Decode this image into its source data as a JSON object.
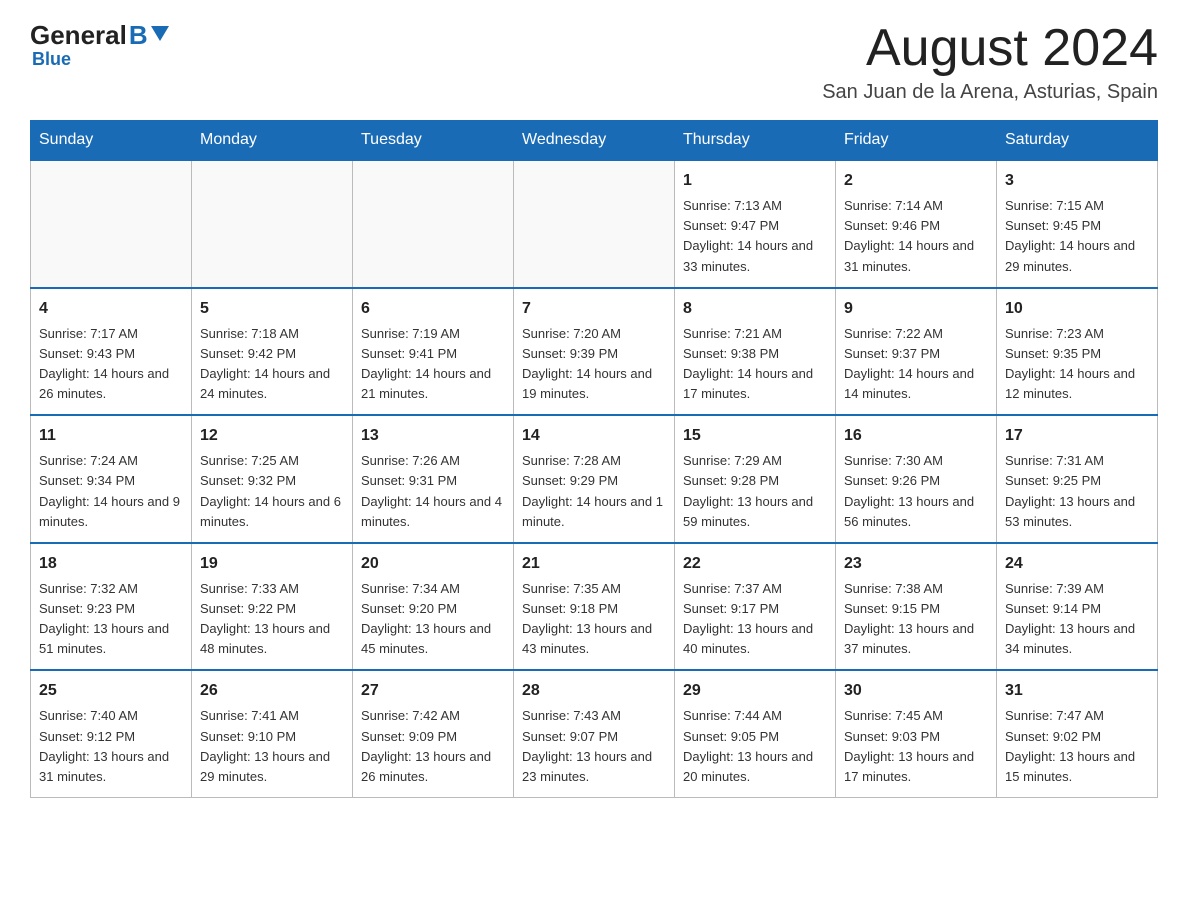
{
  "logo": {
    "text_general": "General",
    "text_blue": "Blue",
    "subtext": "Blue"
  },
  "header": {
    "month_title": "August 2024",
    "location": "San Juan de la Arena, Asturias, Spain"
  },
  "days_of_week": [
    "Sunday",
    "Monday",
    "Tuesday",
    "Wednesday",
    "Thursday",
    "Friday",
    "Saturday"
  ],
  "weeks": [
    [
      {
        "day": "",
        "info": ""
      },
      {
        "day": "",
        "info": ""
      },
      {
        "day": "",
        "info": ""
      },
      {
        "day": "",
        "info": ""
      },
      {
        "day": "1",
        "info": "Sunrise: 7:13 AM\nSunset: 9:47 PM\nDaylight: 14 hours and 33 minutes."
      },
      {
        "day": "2",
        "info": "Sunrise: 7:14 AM\nSunset: 9:46 PM\nDaylight: 14 hours and 31 minutes."
      },
      {
        "day": "3",
        "info": "Sunrise: 7:15 AM\nSunset: 9:45 PM\nDaylight: 14 hours and 29 minutes."
      }
    ],
    [
      {
        "day": "4",
        "info": "Sunrise: 7:17 AM\nSunset: 9:43 PM\nDaylight: 14 hours and 26 minutes."
      },
      {
        "day": "5",
        "info": "Sunrise: 7:18 AM\nSunset: 9:42 PM\nDaylight: 14 hours and 24 minutes."
      },
      {
        "day": "6",
        "info": "Sunrise: 7:19 AM\nSunset: 9:41 PM\nDaylight: 14 hours and 21 minutes."
      },
      {
        "day": "7",
        "info": "Sunrise: 7:20 AM\nSunset: 9:39 PM\nDaylight: 14 hours and 19 minutes."
      },
      {
        "day": "8",
        "info": "Sunrise: 7:21 AM\nSunset: 9:38 PM\nDaylight: 14 hours and 17 minutes."
      },
      {
        "day": "9",
        "info": "Sunrise: 7:22 AM\nSunset: 9:37 PM\nDaylight: 14 hours and 14 minutes."
      },
      {
        "day": "10",
        "info": "Sunrise: 7:23 AM\nSunset: 9:35 PM\nDaylight: 14 hours and 12 minutes."
      }
    ],
    [
      {
        "day": "11",
        "info": "Sunrise: 7:24 AM\nSunset: 9:34 PM\nDaylight: 14 hours and 9 minutes."
      },
      {
        "day": "12",
        "info": "Sunrise: 7:25 AM\nSunset: 9:32 PM\nDaylight: 14 hours and 6 minutes."
      },
      {
        "day": "13",
        "info": "Sunrise: 7:26 AM\nSunset: 9:31 PM\nDaylight: 14 hours and 4 minutes."
      },
      {
        "day": "14",
        "info": "Sunrise: 7:28 AM\nSunset: 9:29 PM\nDaylight: 14 hours and 1 minute."
      },
      {
        "day": "15",
        "info": "Sunrise: 7:29 AM\nSunset: 9:28 PM\nDaylight: 13 hours and 59 minutes."
      },
      {
        "day": "16",
        "info": "Sunrise: 7:30 AM\nSunset: 9:26 PM\nDaylight: 13 hours and 56 minutes."
      },
      {
        "day": "17",
        "info": "Sunrise: 7:31 AM\nSunset: 9:25 PM\nDaylight: 13 hours and 53 minutes."
      }
    ],
    [
      {
        "day": "18",
        "info": "Sunrise: 7:32 AM\nSunset: 9:23 PM\nDaylight: 13 hours and 51 minutes."
      },
      {
        "day": "19",
        "info": "Sunrise: 7:33 AM\nSunset: 9:22 PM\nDaylight: 13 hours and 48 minutes."
      },
      {
        "day": "20",
        "info": "Sunrise: 7:34 AM\nSunset: 9:20 PM\nDaylight: 13 hours and 45 minutes."
      },
      {
        "day": "21",
        "info": "Sunrise: 7:35 AM\nSunset: 9:18 PM\nDaylight: 13 hours and 43 minutes."
      },
      {
        "day": "22",
        "info": "Sunrise: 7:37 AM\nSunset: 9:17 PM\nDaylight: 13 hours and 40 minutes."
      },
      {
        "day": "23",
        "info": "Sunrise: 7:38 AM\nSunset: 9:15 PM\nDaylight: 13 hours and 37 minutes."
      },
      {
        "day": "24",
        "info": "Sunrise: 7:39 AM\nSunset: 9:14 PM\nDaylight: 13 hours and 34 minutes."
      }
    ],
    [
      {
        "day": "25",
        "info": "Sunrise: 7:40 AM\nSunset: 9:12 PM\nDaylight: 13 hours and 31 minutes."
      },
      {
        "day": "26",
        "info": "Sunrise: 7:41 AM\nSunset: 9:10 PM\nDaylight: 13 hours and 29 minutes."
      },
      {
        "day": "27",
        "info": "Sunrise: 7:42 AM\nSunset: 9:09 PM\nDaylight: 13 hours and 26 minutes."
      },
      {
        "day": "28",
        "info": "Sunrise: 7:43 AM\nSunset: 9:07 PM\nDaylight: 13 hours and 23 minutes."
      },
      {
        "day": "29",
        "info": "Sunrise: 7:44 AM\nSunset: 9:05 PM\nDaylight: 13 hours and 20 minutes."
      },
      {
        "day": "30",
        "info": "Sunrise: 7:45 AM\nSunset: 9:03 PM\nDaylight: 13 hours and 17 minutes."
      },
      {
        "day": "31",
        "info": "Sunrise: 7:47 AM\nSunset: 9:02 PM\nDaylight: 13 hours and 15 minutes."
      }
    ]
  ]
}
